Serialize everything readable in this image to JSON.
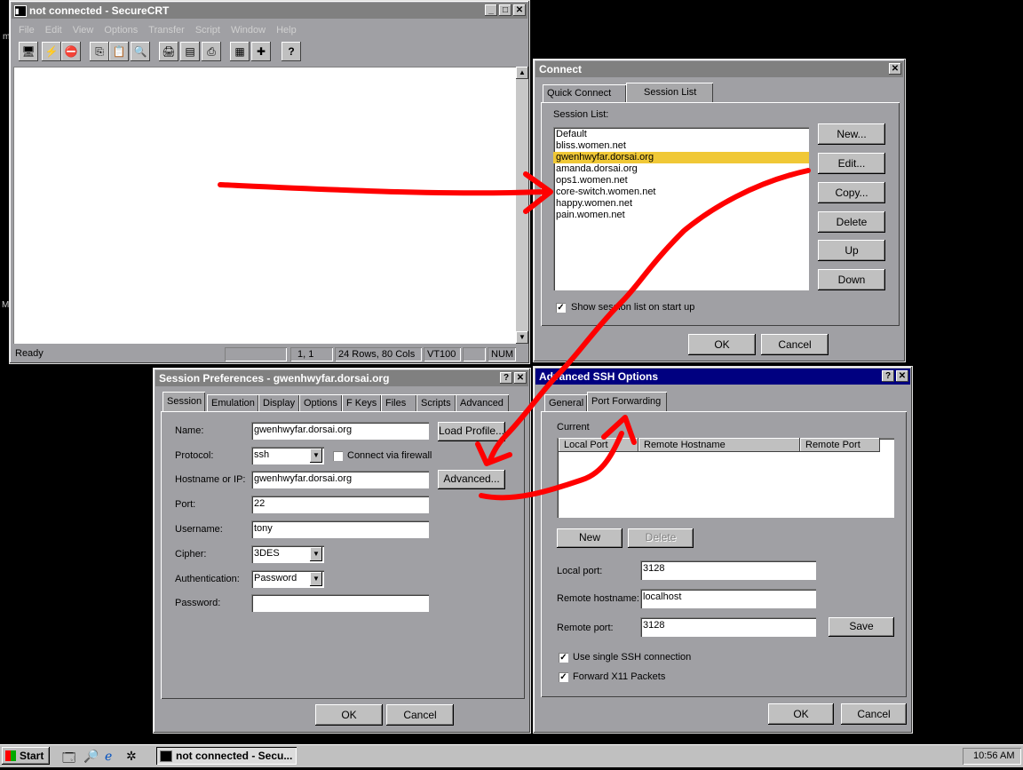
{
  "desktop": {
    "edge_left_top": "m",
    "edge_left_mid": "M"
  },
  "main_window": {
    "title": "not connected - SecureCRT",
    "menu": [
      "File",
      "Edit",
      "View",
      "Options",
      "Transfer",
      "Script",
      "Window",
      "Help"
    ],
    "status": {
      "ready": "Ready",
      "cursor": "1,   1",
      "size": "24 Rows,  80 Cols",
      "term": "VT100",
      "num": "NUM"
    },
    "toolbar_help": "?"
  },
  "connect": {
    "title": "Connect",
    "tabs": [
      "Quick Connect",
      "Session List"
    ],
    "session_list_label": "Session List:",
    "sessions": [
      "Default",
      "bliss.women.net",
      "gwenhwyfar.dorsai.org",
      "amanda.dorsai.org",
      "ops1.women.net",
      "core-switch.women.net",
      "happy.women.net",
      "pain.women.net"
    ],
    "selected_index": 2,
    "buttons": [
      "New...",
      "Edit...",
      "Copy...",
      "Delete",
      "Up",
      "Down"
    ],
    "show_on_startup": "Show session list on start up",
    "ok": "OK",
    "cancel": "Cancel"
  },
  "session_prefs": {
    "title": "Session Preferences - gwenhwyfar.dorsai.org",
    "tabs": [
      "Session",
      "Emulation",
      "Display",
      "Options",
      "F Keys",
      "Files",
      "Scripts",
      "Advanced"
    ],
    "labels": {
      "name": "Name:",
      "protocol": "Protocol:",
      "hostname": "Hostname or IP:",
      "port": "Port:",
      "username": "Username:",
      "cipher": "Cipher:",
      "auth": "Authentication:",
      "password": "Password:"
    },
    "values": {
      "name": "gwenhwyfar.dorsai.org",
      "protocol": "ssh",
      "hostname": "gwenhwyfar.dorsai.org",
      "port": "22",
      "username": "tony",
      "cipher": "3DES",
      "auth": "Password",
      "password": ""
    },
    "firewall": "Connect via firewall",
    "load_profile": "Load Profile...",
    "advanced": "Advanced...",
    "ok": "OK",
    "cancel": "Cancel"
  },
  "ssh_options": {
    "title": "Advanced SSH Options",
    "tabs": [
      "General",
      "Port Forwarding"
    ],
    "current_label": "Current",
    "columns": [
      "Local Port",
      "Remote Hostname",
      "Remote Port"
    ],
    "new": "New",
    "delete": "Delete",
    "labels": {
      "local_port": "Local port:",
      "remote_host": "Remote hostname:",
      "remote_port": "Remote port:"
    },
    "values": {
      "local_port": "3128",
      "remote_host": "localhost",
      "remote_port": "3128"
    },
    "save": "Save",
    "single_ssh": "Use single SSH connection",
    "forward_x11": "Forward X11 Packets",
    "ok": "OK",
    "cancel": "Cancel"
  },
  "taskbar": {
    "start": "Start",
    "task": "not connected - Secu...",
    "clock": "10:56 AM"
  }
}
